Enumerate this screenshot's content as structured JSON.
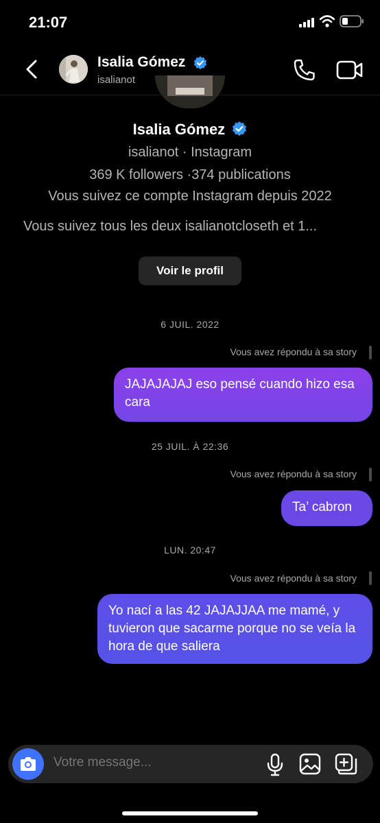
{
  "status_bar": {
    "time": "21:07"
  },
  "header": {
    "name": "Isalia Gómez",
    "username": "isalianot"
  },
  "profile": {
    "name": "Isalia Gómez",
    "subtitle": "isalianot · Instagram",
    "stats": "369 K followers ·374 publications",
    "following_since": "Vous suivez ce compte Instagram depuis 2022",
    "mutual": "Vous suivez tous les deux isalianotcloseth et 1...",
    "view_profile_label": "Voir le profil"
  },
  "messages": [
    {
      "date": "6 JUIL. 2022",
      "note": "Vous avez répondu à sa story",
      "text": "JAJAJAJAJ eso pensé cuando hizo esa cara"
    },
    {
      "date": "25 JUIL. À 22:36",
      "note": "Vous avez répondu à sa story",
      "text": "Ta’ cabron"
    },
    {
      "date": "LUN. 20:47",
      "note": "Vous avez répondu à sa story",
      "text": "Yo nací a las 42 JAJAJJAA me mamé, y tuvieron que sacarme porque no se veía la hora de que saliera"
    }
  ],
  "composer": {
    "placeholder": "Votre message..."
  },
  "colors": {
    "bubble_top": "#8a3ee8",
    "bubble_mid": "#6a48e6",
    "bubble_bottom": "#5a50e8",
    "verified": "#3897f0",
    "camera": "#3f72ff"
  },
  "icons": [
    "back-icon",
    "verified-icon",
    "phone-icon",
    "video-icon",
    "camera-icon",
    "microphone-icon",
    "gallery-icon",
    "sticker-icon",
    "signal-icon",
    "wifi-icon",
    "battery-icon"
  ]
}
